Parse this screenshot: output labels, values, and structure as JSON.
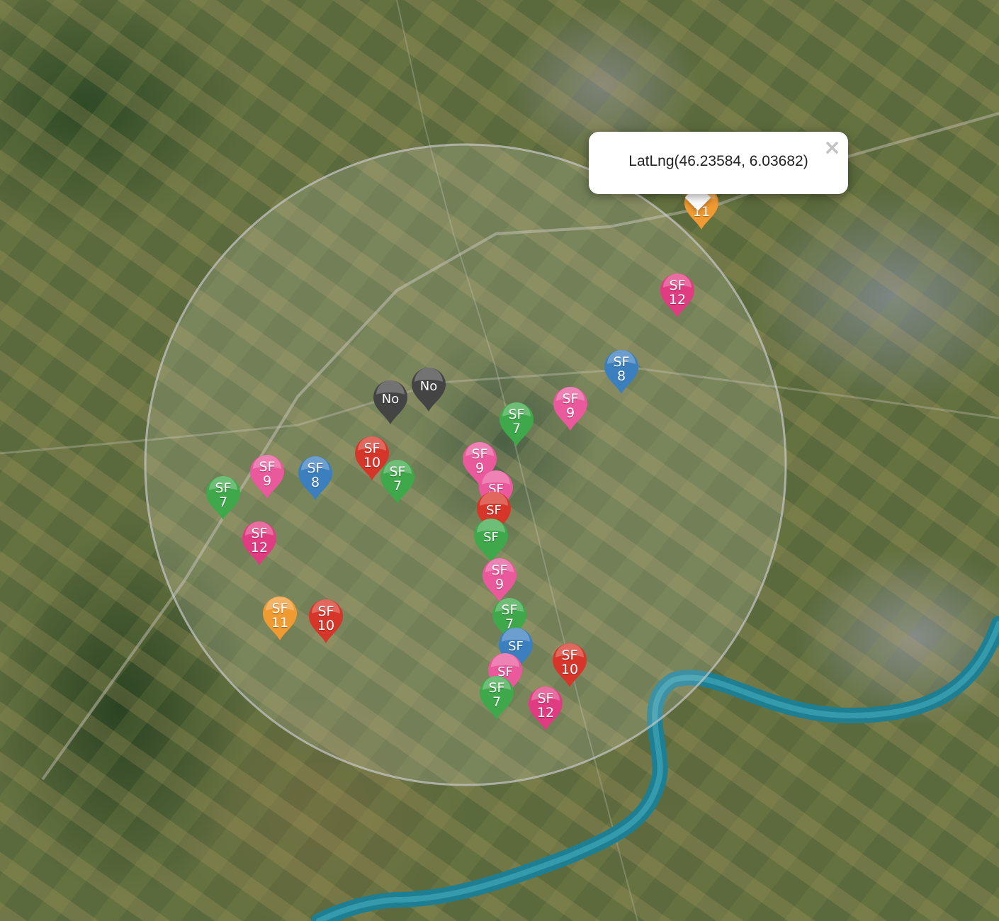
{
  "map": {
    "view": "satellite",
    "river_color": "#1e7f93",
    "search_radius_circle": {
      "visible": true,
      "stroke": "#c8c8c8"
    }
  },
  "popup": {
    "text": "LatLng(46.23584, 6.03682)",
    "close_symbol": "×"
  },
  "marker_colors": {
    "7": "#3ea84a",
    "8": "#3b7fbf",
    "9": "#e9599c",
    "10": "#d6362a",
    "11": "#f09a32",
    "12": "#e03c82",
    "No": "#444444"
  },
  "markers": [
    {
      "top": "SF",
      "bottom": "11",
      "kind": "11"
    },
    {
      "top": "SF",
      "bottom": "12",
      "kind": "12"
    },
    {
      "top": "SF",
      "bottom": "8",
      "kind": "8"
    },
    {
      "top": "SF",
      "bottom": "9",
      "kind": "9"
    },
    {
      "top": "SF",
      "bottom": "7",
      "kind": "7"
    },
    {
      "top": "No",
      "bottom": "",
      "kind": "No"
    },
    {
      "top": "No",
      "bottom": "",
      "kind": "No"
    },
    {
      "top": "SF",
      "bottom": "10",
      "kind": "10"
    },
    {
      "top": "SF",
      "bottom": "7",
      "kind": "7"
    },
    {
      "top": "SF",
      "bottom": "9",
      "kind": "9"
    },
    {
      "top": "SF",
      "bottom": "8",
      "kind": "8"
    },
    {
      "top": "SF",
      "bottom": "7",
      "kind": "7"
    },
    {
      "top": "SF",
      "bottom": "12",
      "kind": "12"
    },
    {
      "top": "SF",
      "bottom": "11",
      "kind": "11"
    },
    {
      "top": "SF",
      "bottom": "10",
      "kind": "10"
    },
    {
      "top": "SF",
      "bottom": "9",
      "kind": "9"
    },
    {
      "top": "SF",
      "bottom": "",
      "kind": "9"
    },
    {
      "top": "SF",
      "bottom": "",
      "kind": "10"
    },
    {
      "top": "SF",
      "bottom": "",
      "kind": "7"
    },
    {
      "top": "SF",
      "bottom": "9",
      "kind": "9"
    },
    {
      "top": "SF",
      "bottom": "7",
      "kind": "7"
    },
    {
      "top": "SF",
      "bottom": "",
      "kind": "8"
    },
    {
      "top": "SF",
      "bottom": "",
      "kind": "9"
    },
    {
      "top": "SF",
      "bottom": "7",
      "kind": "7"
    },
    {
      "top": "SF",
      "bottom": "10",
      "kind": "10"
    },
    {
      "top": "SF",
      "bottom": "12",
      "kind": "12"
    }
  ]
}
